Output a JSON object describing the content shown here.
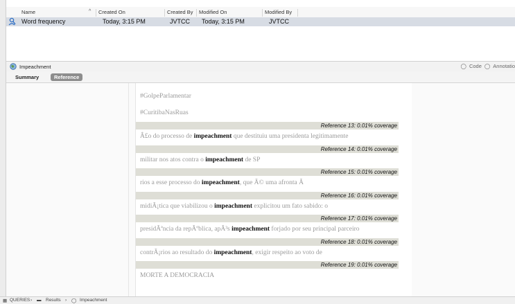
{
  "list_header": {
    "columns": [
      "Name",
      "Created On",
      "Created By",
      "Modified On",
      "Modified By"
    ]
  },
  "query_row": {
    "name": "Word frequency",
    "created_on": "Today, 3:15 PM",
    "created_by": "JVTCC",
    "modified_on": "Today, 3:15 PM",
    "modified_by": "JVTCC"
  },
  "node_bar": {
    "title": "Impeachment",
    "code_label": "Code",
    "annotations_label": "Annotatio"
  },
  "tabs": {
    "summary": "Summary",
    "reference": "Reference"
  },
  "doc": {
    "pre": [
      "#GolpeParlamentar",
      "#CuritibaNasRuas"
    ],
    "refs": [
      {
        "ref": "Reference 13: 0.01% coverage",
        "before": "Â£o do processo de ",
        "keyword": "impeachment",
        "after": " que destituiu uma presidenta legitimamente"
      },
      {
        "ref": "Reference 14: 0.01% coverage",
        "before": "militar nos atos contra o ",
        "keyword": "impeachment",
        "after": " de SP"
      },
      {
        "ref": "Reference 15: 0.01% coverage",
        "before": "rios a esse processo do ",
        "keyword": "impeachment",
        "after": ", que Ã© uma afronta Ã"
      },
      {
        "ref": "Reference 16: 0.01% coverage",
        "before": "midiÃ¡tica que viabilizou o ",
        "keyword": "impeachment",
        "after": "  explicitou um fato sabido: o"
      },
      {
        "ref": "Reference 17: 0.01% coverage",
        "before": "presidÃªncia da repÃºblica, apÃ³s ",
        "keyword": "impeachment",
        "after": " forjado por seu principal parceiro"
      },
      {
        "ref": "Reference 18: 0.01% coverage",
        "before": "contrÃ¡rios ao resultado do ",
        "keyword": "impeachment",
        "after": ", exigir respeito ao voto de"
      },
      {
        "ref": "Reference 19: 0.01% coverage",
        "before": "MORTE A DEMOCRACIA",
        "keyword": "",
        "after": ""
      }
    ]
  },
  "breadcrumb": {
    "part1": "QUERIES",
    "part2": "Results",
    "part3": "Impeachment"
  }
}
